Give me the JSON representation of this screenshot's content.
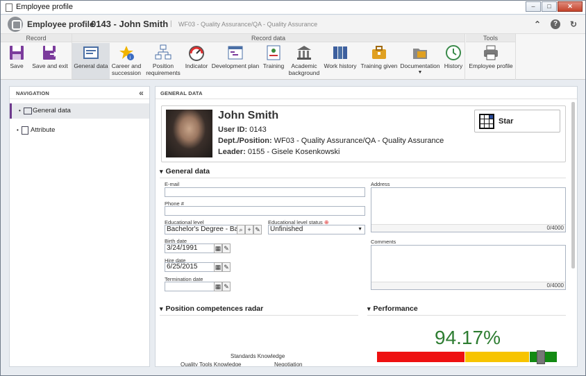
{
  "window": {
    "title": "Employee profile"
  },
  "header": {
    "breadcrumb": "Employee profile",
    "separator": "›",
    "record": "0143 - John Smith",
    "bar": "|",
    "subtitle": "WF03 - Quality Assurance/QA - Quality Assurance"
  },
  "ribbon": {
    "groups": {
      "record": "Record",
      "record_data": "Record data",
      "tools": "Tools"
    },
    "buttons": [
      {
        "label": "Save"
      },
      {
        "label": "Save and exit"
      },
      {
        "label": "General data"
      },
      {
        "label": "Career and succession"
      },
      {
        "label": "Position requirements"
      },
      {
        "label": "Indicator"
      },
      {
        "label": "Development plan"
      },
      {
        "label": "Training"
      },
      {
        "label": "Academic background"
      },
      {
        "label": "Work history"
      },
      {
        "label": "Training given"
      },
      {
        "label": "Documentation"
      },
      {
        "label": "History"
      },
      {
        "label": "Employee profile"
      }
    ]
  },
  "nav": {
    "title": "NAVIGATION",
    "items": [
      {
        "label": "General data"
      },
      {
        "label": "Attribute"
      }
    ]
  },
  "main": {
    "title": "GENERAL DATA",
    "card": {
      "name": "John Smith",
      "userid_label": "User ID:",
      "userid": "0143",
      "dept_label": "Dept./Position:",
      "dept": "WF03 - Quality Assurance/QA - Quality Assurance",
      "leader_label": "Leader:",
      "leader": "0155 - Gisele Kosenkowski",
      "star_label": "Star"
    },
    "general": {
      "title": "General data",
      "email_label": "E-mail",
      "email": "",
      "phone_label": "Phone #",
      "phone": "",
      "edu_label": "Educational level",
      "edu": "Bachelor's Degree - Bac",
      "edu_status_label": "Educational level status",
      "edu_status": "Unfinished",
      "birth_label": "Birth date",
      "birth": "3/24/1991",
      "hire_label": "Hire date",
      "hire": "6/25/2015",
      "term_label": "Termination date",
      "term": "",
      "address_label": "Address",
      "address_count": "0/4000",
      "comments_label": "Comments",
      "comments_count": "0/4000"
    },
    "radar": {
      "title": "Position competences radar",
      "labels": [
        "Standards Knowledge",
        "Quality Tools Knowledge",
        "Negotiation"
      ]
    },
    "performance": {
      "title": "Performance",
      "value_text": "94.17%",
      "value": 94.17,
      "colors": {
        "red": "#ee1111",
        "yellow": "#f7c400",
        "green": "#138a13"
      }
    }
  }
}
